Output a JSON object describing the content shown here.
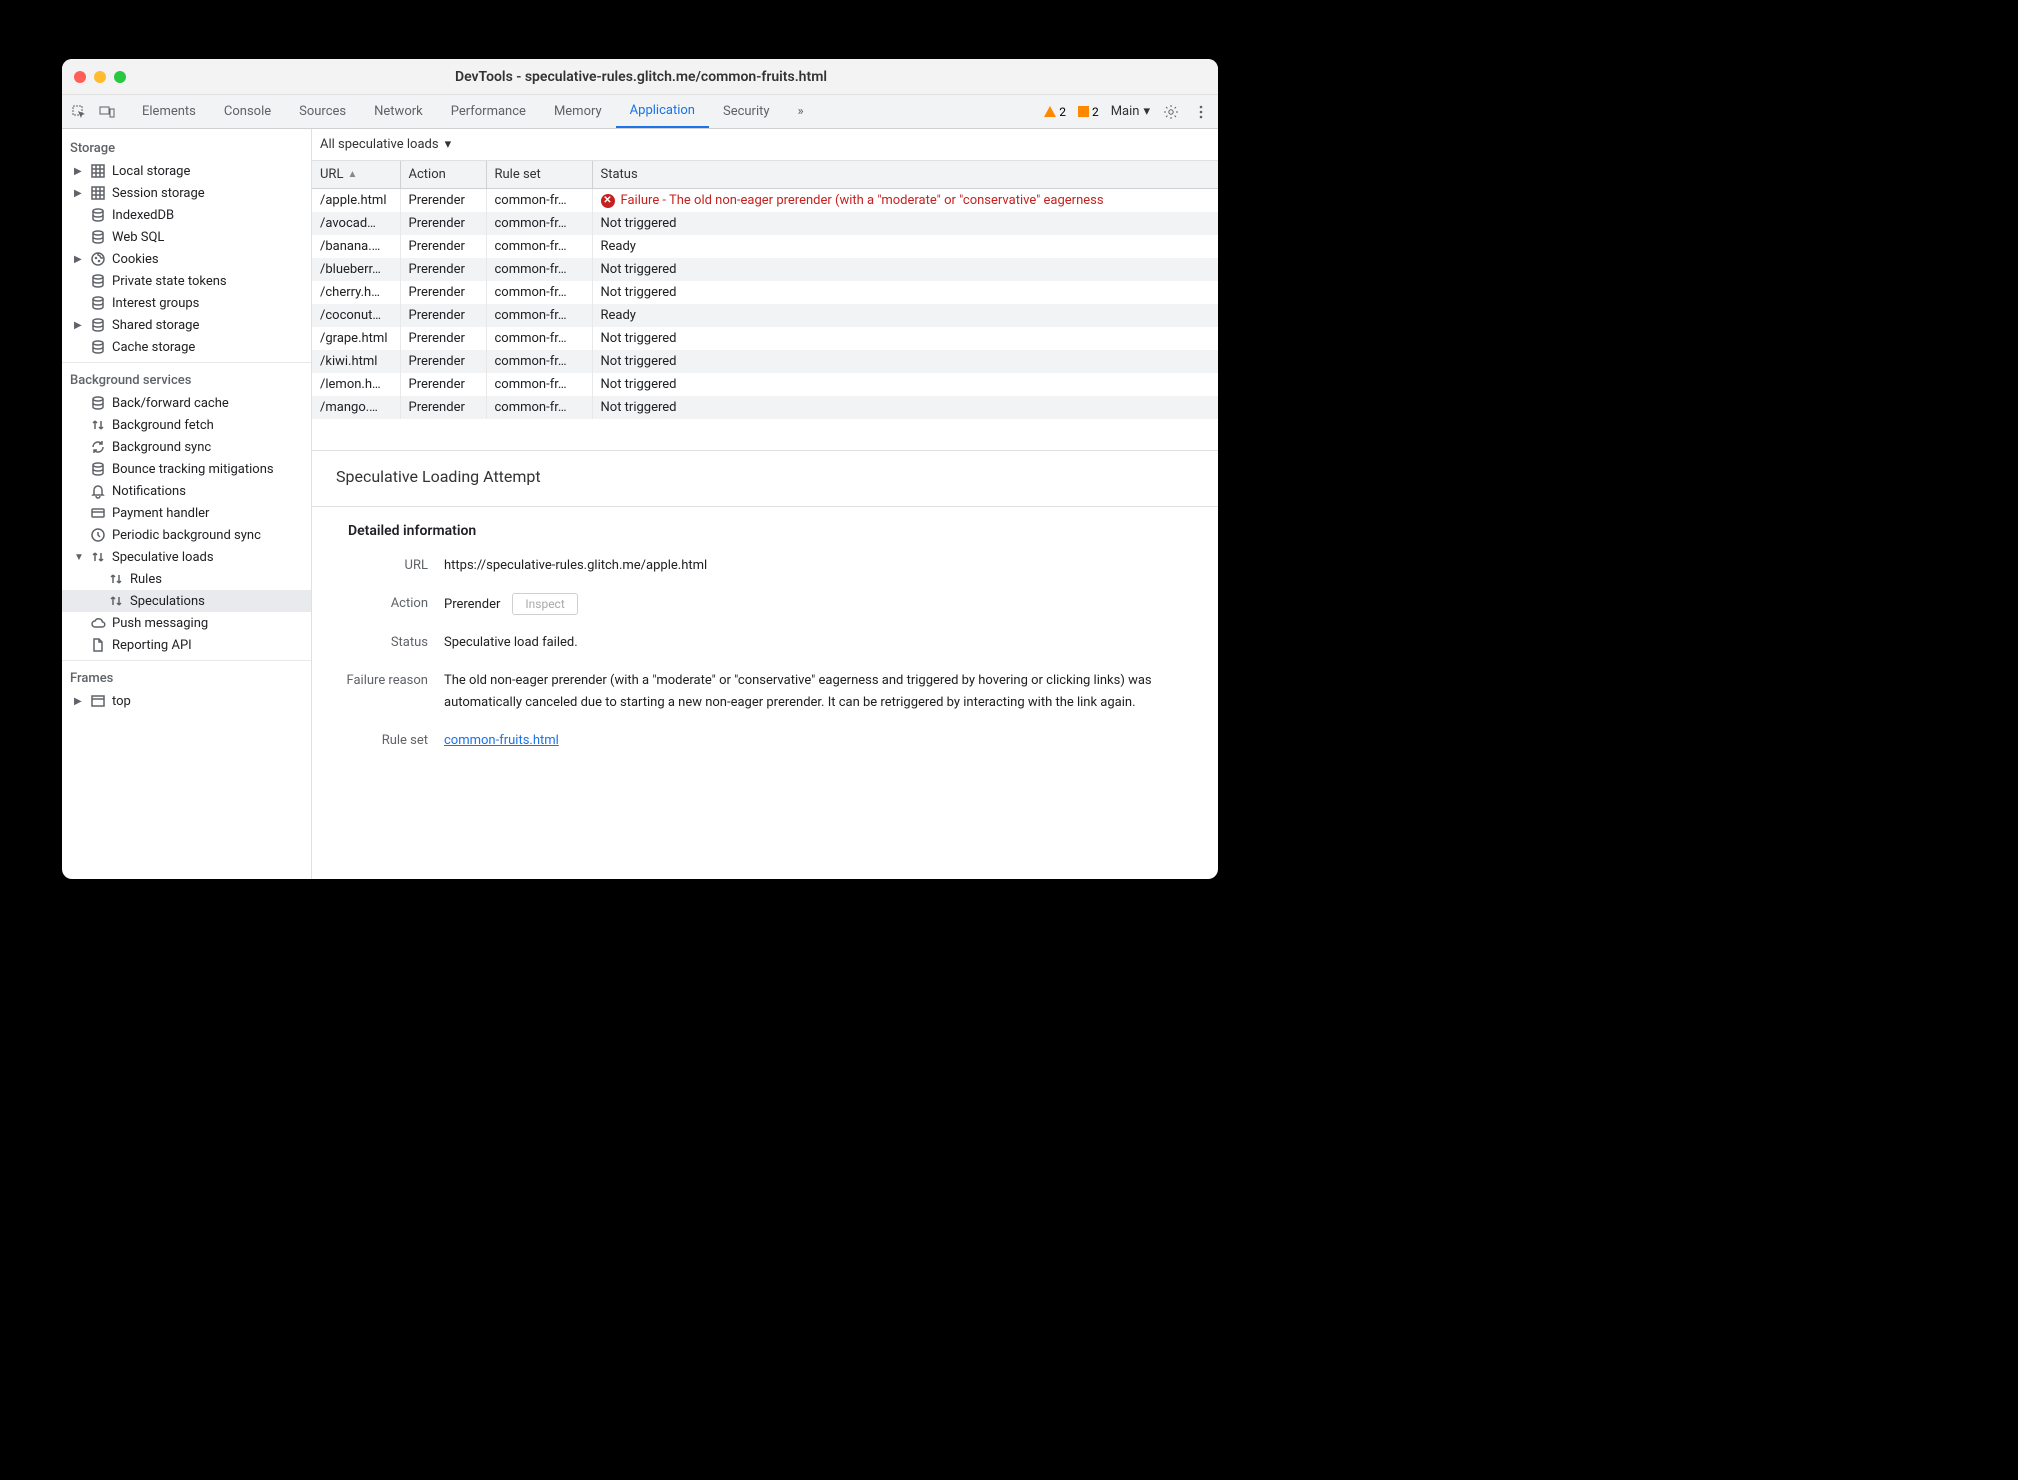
{
  "window_title": "DevTools - speculative-rules.glitch.me/common-fruits.html",
  "tabs": [
    "Elements",
    "Console",
    "Sources",
    "Network",
    "Performance",
    "Memory",
    "Application",
    "Security"
  ],
  "active_tab": "Application",
  "more_tabs_icon": "»",
  "badge_warn_count": "2",
  "badge_info_count": "2",
  "main_dropdown": "Main",
  "sidebar": {
    "storage_title": "Storage",
    "storage_items": [
      {
        "icon": "grid",
        "label": "Local storage",
        "expandable": true
      },
      {
        "icon": "grid",
        "label": "Session storage",
        "expandable": true
      },
      {
        "icon": "db",
        "label": "IndexedDB"
      },
      {
        "icon": "db",
        "label": "Web SQL"
      },
      {
        "icon": "cookie",
        "label": "Cookies",
        "expandable": true
      },
      {
        "icon": "db",
        "label": "Private state tokens"
      },
      {
        "icon": "db",
        "label": "Interest groups"
      },
      {
        "icon": "db",
        "label": "Shared storage",
        "expandable": true
      },
      {
        "icon": "db",
        "label": "Cache storage"
      }
    ],
    "bg_title": "Background services",
    "bg_items": [
      {
        "icon": "db",
        "label": "Back/forward cache"
      },
      {
        "icon": "updown",
        "label": "Background fetch"
      },
      {
        "icon": "sync",
        "label": "Background sync"
      },
      {
        "icon": "db",
        "label": "Bounce tracking mitigations"
      },
      {
        "icon": "bell",
        "label": "Notifications"
      },
      {
        "icon": "card",
        "label": "Payment handler"
      },
      {
        "icon": "clock",
        "label": "Periodic background sync"
      },
      {
        "icon": "updown",
        "label": "Speculative loads",
        "expandable": true,
        "expanded": true,
        "children": [
          {
            "icon": "updown",
            "label": "Rules"
          },
          {
            "icon": "updown",
            "label": "Speculations",
            "selected": true
          }
        ]
      },
      {
        "icon": "cloud",
        "label": "Push messaging"
      },
      {
        "icon": "doc",
        "label": "Reporting API"
      }
    ],
    "frames_title": "Frames",
    "frames_items": [
      {
        "icon": "frame",
        "label": "top",
        "expandable": true
      }
    ]
  },
  "filter": "All speculative loads",
  "table_headers": {
    "url": "URL",
    "action": "Action",
    "ruleset": "Rule set",
    "status": "Status"
  },
  "rows": [
    {
      "url": "/apple.html",
      "action": "Prerender",
      "ruleset": "common-fr…",
      "status": "Failure - The old non-eager prerender (with a \"moderate\" or \"conservative\" eagerness",
      "fail": true
    },
    {
      "url": "/avocad…",
      "action": "Prerender",
      "ruleset": "common-fr…",
      "status": "Not triggered"
    },
    {
      "url": "/banana.…",
      "action": "Prerender",
      "ruleset": "common-fr…",
      "status": "Ready"
    },
    {
      "url": "/blueberr…",
      "action": "Prerender",
      "ruleset": "common-fr…",
      "status": "Not triggered"
    },
    {
      "url": "/cherry.h…",
      "action": "Prerender",
      "ruleset": "common-fr…",
      "status": "Not triggered"
    },
    {
      "url": "/coconut…",
      "action": "Prerender",
      "ruleset": "common-fr…",
      "status": "Ready"
    },
    {
      "url": "/grape.html",
      "action": "Prerender",
      "ruleset": "common-fr…",
      "status": "Not triggered"
    },
    {
      "url": "/kiwi.html",
      "action": "Prerender",
      "ruleset": "common-fr…",
      "status": "Not triggered"
    },
    {
      "url": "/lemon.h…",
      "action": "Prerender",
      "ruleset": "common-fr…",
      "status": "Not triggered"
    },
    {
      "url": "/mango.…",
      "action": "Prerender",
      "ruleset": "common-fr…",
      "status": "Not triggered"
    }
  ],
  "detail": {
    "title": "Speculative Loading Attempt",
    "section_title": "Detailed information",
    "url_label": "URL",
    "url": "https://speculative-rules.glitch.me/apple.html",
    "action_label": "Action",
    "action": "Prerender",
    "inspect": "Inspect",
    "status_label": "Status",
    "status": "Speculative load failed.",
    "reason_label": "Failure reason",
    "reason": "The old non-eager prerender (with a \"moderate\" or \"conservative\" eagerness and triggered by hovering or clicking links) was automatically canceled due to starting a new non-eager prerender. It can be retriggered by interacting with the link again.",
    "ruleset_label": "Rule set",
    "ruleset": "common-fruits.html"
  }
}
